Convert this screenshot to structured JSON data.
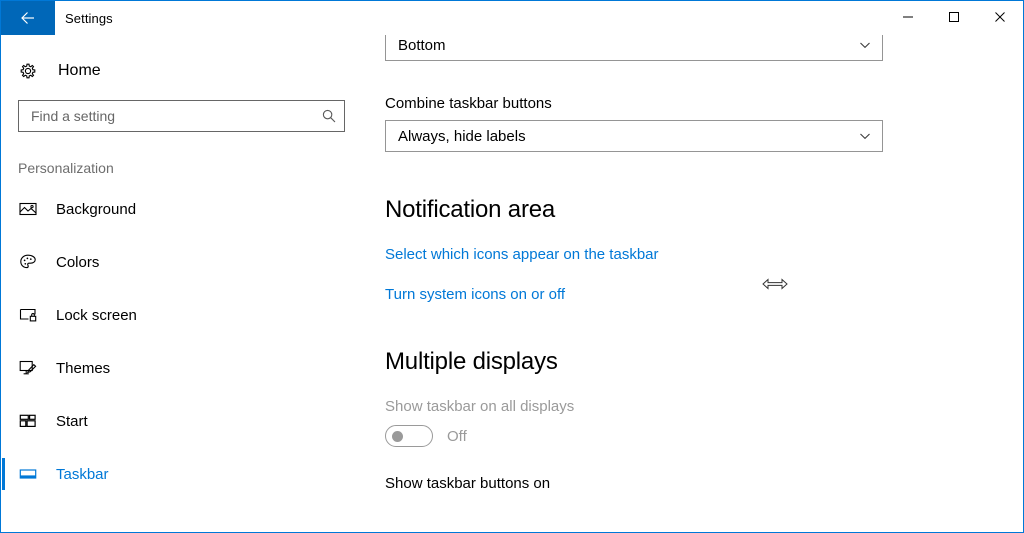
{
  "window": {
    "title": "Settings",
    "back_icon": "back-arrow-icon",
    "controls": {
      "minimize": "minimize-icon",
      "maximize": "maximize-icon",
      "close": "close-icon"
    },
    "border_color": "#0078d7"
  },
  "sidebar": {
    "home": {
      "label": "Home",
      "icon": "gear-icon"
    },
    "search": {
      "value": "",
      "placeholder": "Find a setting",
      "icon": "search-icon"
    },
    "group_label": "Personalization",
    "items": [
      {
        "label": "Background",
        "icon": "picture-icon",
        "selected": false
      },
      {
        "label": "Colors",
        "icon": "palette-icon",
        "selected": false
      },
      {
        "label": "Lock screen",
        "icon": "lock-screen-icon",
        "selected": false
      },
      {
        "label": "Themes",
        "icon": "brush-icon",
        "selected": false
      },
      {
        "label": "Start",
        "icon": "start-tiles-icon",
        "selected": false
      },
      {
        "label": "Taskbar",
        "icon": "taskbar-icon",
        "selected": true
      }
    ],
    "accent_color": "#0078d7"
  },
  "content": {
    "taskbar_location": {
      "value": "Bottom",
      "chevron": "chevron-down-icon"
    },
    "combine_buttons": {
      "label": "Combine taskbar buttons",
      "value": "Always, hide labels",
      "chevron": "chevron-down-icon"
    },
    "notification_area": {
      "heading": "Notification area",
      "links": [
        "Select which icons appear on the taskbar",
        "Turn system icons on or off"
      ]
    },
    "multiple_displays": {
      "heading": "Multiple displays",
      "toggle_label": "Show taskbar on all displays",
      "toggle_state": "Off",
      "toggle_enabled": false,
      "buttons_label": "Show taskbar buttons on"
    }
  },
  "cursor": {
    "icon": "horizontal-resize-cursor-icon"
  }
}
